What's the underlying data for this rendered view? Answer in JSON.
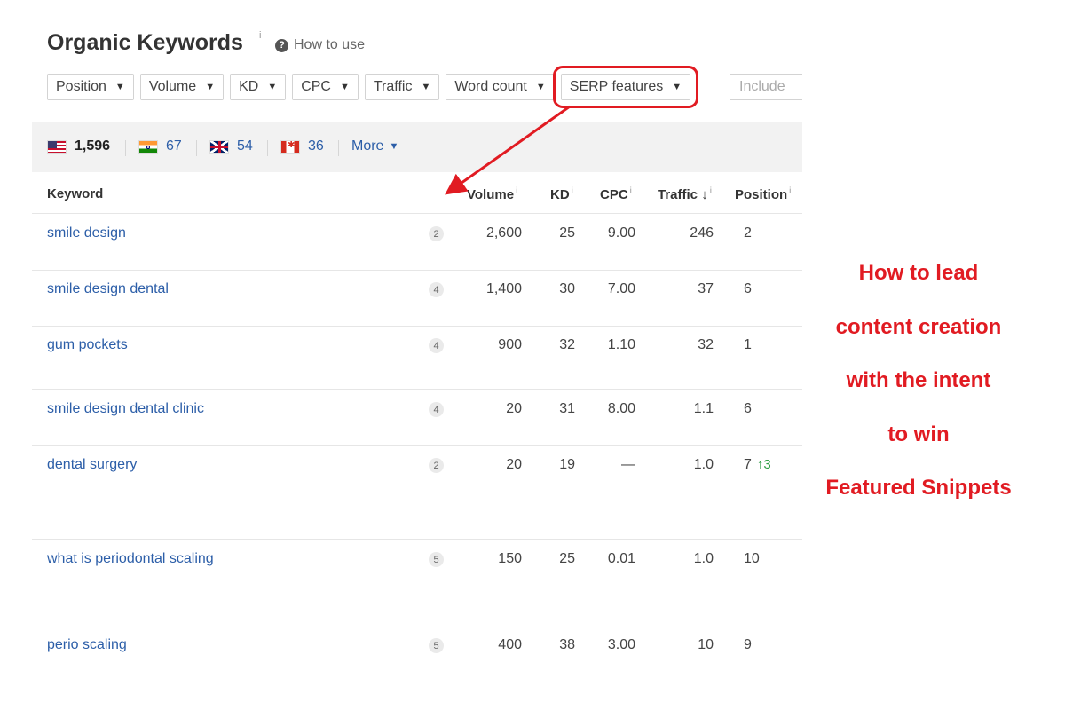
{
  "header": {
    "title": "Organic Keywords",
    "info_mark": "i",
    "help_icon": "?",
    "help_label": "How to use"
  },
  "filters": [
    {
      "label": "Position"
    },
    {
      "label": "Volume"
    },
    {
      "label": "KD"
    },
    {
      "label": "CPC"
    },
    {
      "label": "Traffic"
    },
    {
      "label": "Word count"
    },
    {
      "label": "SERP features"
    }
  ],
  "include_placeholder": "Include",
  "countries": [
    {
      "flag": "us-flag-icon",
      "value": "1,596"
    },
    {
      "flag": "india-flag-icon",
      "value": "67"
    },
    {
      "flag": "uk-flag-icon",
      "value": "54"
    },
    {
      "flag": "canada-flag-icon",
      "value": "36"
    }
  ],
  "more_label": "More",
  "table": {
    "columns": {
      "keyword": "Keyword",
      "volume": "Volume",
      "kd": "KD",
      "cpc": "CPC",
      "traffic": "Traffic",
      "traffic_sort": "↓",
      "position": "Position",
      "info_mark": "i"
    },
    "rows": [
      {
        "keyword": "smile design",
        "serp": "2",
        "volume": "2,600",
        "kd": "25",
        "cpc": "9.00",
        "traffic": "246",
        "position": "2",
        "change": ""
      },
      {
        "keyword": "smile design dental",
        "serp": "4",
        "volume": "1,400",
        "kd": "30",
        "cpc": "7.00",
        "traffic": "37",
        "position": "6",
        "change": ""
      },
      {
        "keyword": "gum pockets",
        "serp": "4",
        "volume": "900",
        "kd": "32",
        "cpc": "1.10",
        "traffic": "32",
        "position": "1",
        "change": ""
      },
      {
        "keyword": "smile design dental clinic",
        "serp": "4",
        "volume": "20",
        "kd": "31",
        "cpc": "8.00",
        "traffic": "1.1",
        "position": "6",
        "change": ""
      },
      {
        "keyword": "dental surgery",
        "serp": "2",
        "volume": "20",
        "kd": "19",
        "cpc": "—",
        "traffic": "1.0",
        "position": "7",
        "change": "↑3"
      },
      {
        "keyword": "what is periodontal scaling",
        "serp": "5",
        "volume": "150",
        "kd": "25",
        "cpc": "0.01",
        "traffic": "1.0",
        "position": "10",
        "change": ""
      },
      {
        "keyword": "perio scaling",
        "serp": "5",
        "volume": "400",
        "kd": "38",
        "cpc": "3.00",
        "traffic": "10",
        "position": "9",
        "change": ""
      }
    ]
  },
  "annotation": {
    "lines": [
      "How to lead",
      "content creation",
      "with the intent",
      "to win",
      "Featured Snippets"
    ],
    "color": "#e11b22"
  },
  "colors": {
    "link": "#2c5ea8",
    "highlight": "#e11b22",
    "positive_change": "#2e9e44"
  }
}
